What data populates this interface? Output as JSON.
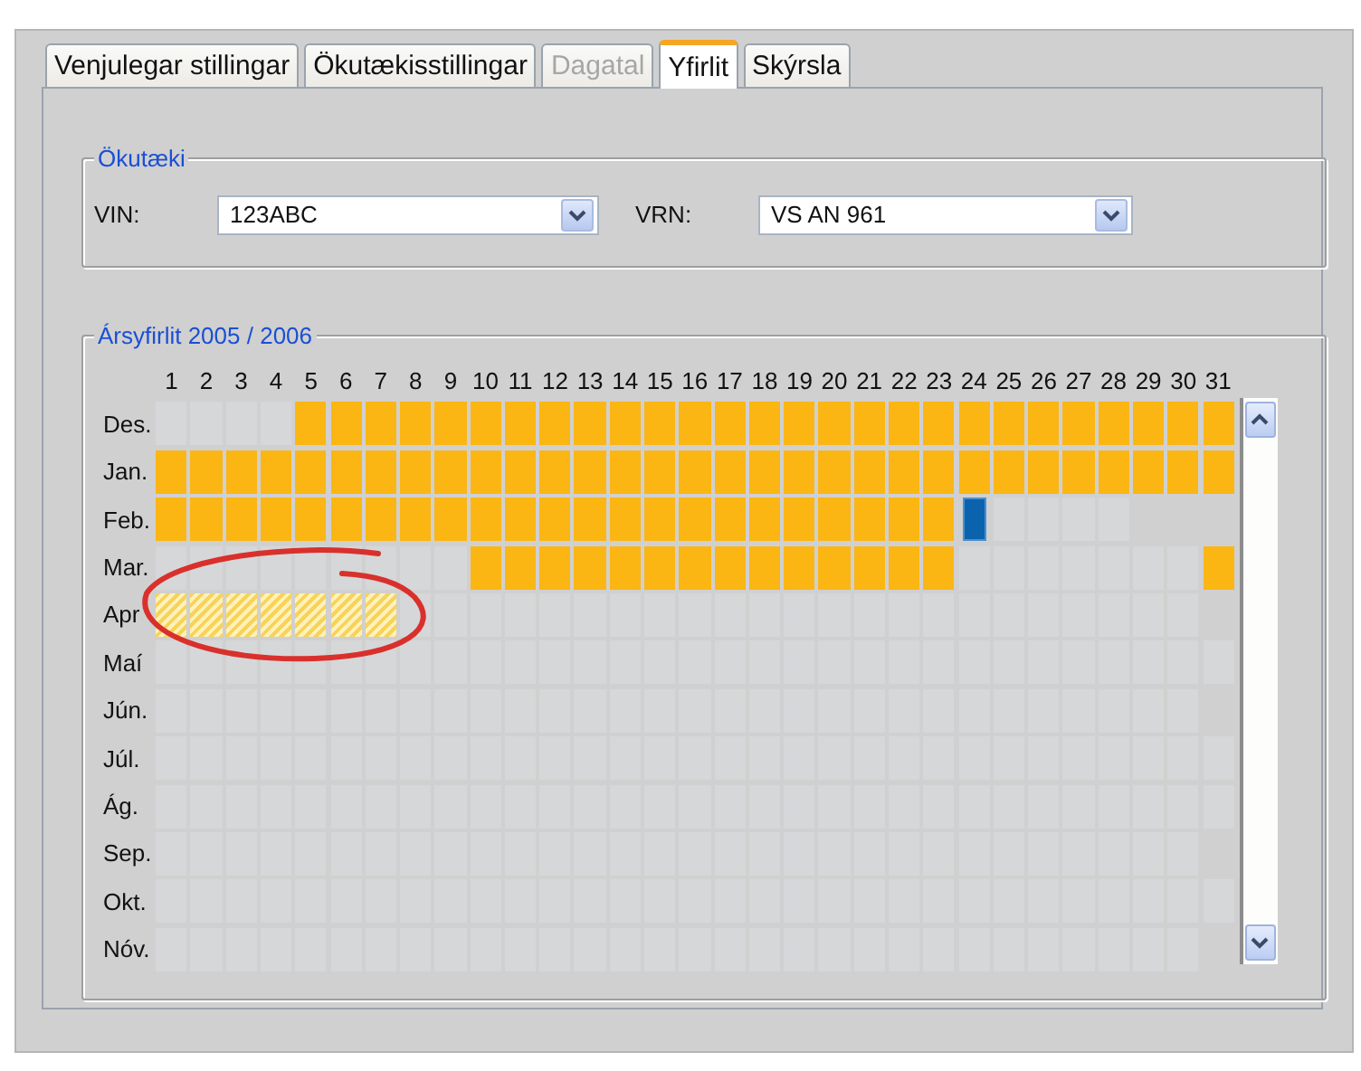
{
  "tabs": [
    {
      "label": "Venjulegar stillingar",
      "selected": false,
      "disabled": false
    },
    {
      "label": "Ökutækisstillingar",
      "selected": false,
      "disabled": false
    },
    {
      "label": "Dagatal",
      "selected": false,
      "disabled": true
    },
    {
      "label": "Yfirlit",
      "selected": true,
      "disabled": false
    },
    {
      "label": "Skýrsla",
      "selected": false,
      "disabled": false
    }
  ],
  "vehicle": {
    "title": "Ökutæki",
    "vin": {
      "label": "VIN:",
      "value": "123ABC"
    },
    "vrn": {
      "label": "VRN:",
      "value": "VS AN 961"
    }
  },
  "year_overview": {
    "title": "Ársyfirlit 2005 / 2006",
    "day_numbers": [
      "1",
      "2",
      "3",
      "4",
      "5",
      "6",
      "7",
      "8",
      "9",
      "10",
      "11",
      "12",
      "13",
      "14",
      "15",
      "16",
      "17",
      "18",
      "19",
      "20",
      "21",
      "22",
      "23",
      "24",
      "25",
      "26",
      "27",
      "28",
      "29",
      "30",
      "31"
    ],
    "months": [
      {
        "label": "Des.",
        "days": [
          {
            "kind": "empty"
          },
          {
            "kind": "empty"
          },
          {
            "kind": "empty"
          },
          {
            "kind": "empty"
          },
          {
            "kind": "filled"
          },
          {
            "kind": "filled"
          },
          {
            "kind": "filled"
          },
          {
            "kind": "filled"
          },
          {
            "kind": "filled"
          },
          {
            "kind": "filled"
          },
          {
            "kind": "filled"
          },
          {
            "kind": "filled"
          },
          {
            "kind": "filled"
          },
          {
            "kind": "filled"
          },
          {
            "kind": "filled"
          },
          {
            "kind": "filled"
          },
          {
            "kind": "filled"
          },
          {
            "kind": "filled"
          },
          {
            "kind": "filled"
          },
          {
            "kind": "filled"
          },
          {
            "kind": "filled"
          },
          {
            "kind": "filled"
          },
          {
            "kind": "filled"
          },
          {
            "kind": "filled"
          },
          {
            "kind": "filled"
          },
          {
            "kind": "filled"
          },
          {
            "kind": "filled"
          },
          {
            "kind": "filled"
          },
          {
            "kind": "filled"
          },
          {
            "kind": "filled"
          },
          {
            "kind": "filled"
          }
        ]
      },
      {
        "label": "Jan.",
        "days": [
          {
            "kind": "filled"
          },
          {
            "kind": "filled"
          },
          {
            "kind": "filled"
          },
          {
            "kind": "filled"
          },
          {
            "kind": "filled"
          },
          {
            "kind": "filled"
          },
          {
            "kind": "filled"
          },
          {
            "kind": "filled"
          },
          {
            "kind": "filled"
          },
          {
            "kind": "filled"
          },
          {
            "kind": "filled"
          },
          {
            "kind": "filled"
          },
          {
            "kind": "filled"
          },
          {
            "kind": "filled"
          },
          {
            "kind": "filled"
          },
          {
            "kind": "filled"
          },
          {
            "kind": "filled"
          },
          {
            "kind": "filled"
          },
          {
            "kind": "filled"
          },
          {
            "kind": "filled"
          },
          {
            "kind": "filled"
          },
          {
            "kind": "filled"
          },
          {
            "kind": "filled"
          },
          {
            "kind": "filled"
          },
          {
            "kind": "filled"
          },
          {
            "kind": "filled"
          },
          {
            "kind": "filled"
          },
          {
            "kind": "filled"
          },
          {
            "kind": "filled"
          },
          {
            "kind": "filled"
          },
          {
            "kind": "filled"
          }
        ]
      },
      {
        "label": "Feb.",
        "days": [
          {
            "kind": "filled"
          },
          {
            "kind": "filled"
          },
          {
            "kind": "filled"
          },
          {
            "kind": "filled"
          },
          {
            "kind": "filled"
          },
          {
            "kind": "filled"
          },
          {
            "kind": "filled"
          },
          {
            "kind": "filled"
          },
          {
            "kind": "filled"
          },
          {
            "kind": "filled"
          },
          {
            "kind": "filled"
          },
          {
            "kind": "filled"
          },
          {
            "kind": "filled"
          },
          {
            "kind": "filled"
          },
          {
            "kind": "filled"
          },
          {
            "kind": "filled"
          },
          {
            "kind": "filled"
          },
          {
            "kind": "filled"
          },
          {
            "kind": "filled"
          },
          {
            "kind": "filled"
          },
          {
            "kind": "filled"
          },
          {
            "kind": "filled"
          },
          {
            "kind": "filled"
          },
          {
            "kind": "selected"
          },
          {
            "kind": "empty"
          },
          {
            "kind": "empty"
          },
          {
            "kind": "empty"
          },
          {
            "kind": "empty"
          }
        ]
      },
      {
        "label": "Mar.",
        "days": [
          {
            "kind": "empty"
          },
          {
            "kind": "empty"
          },
          {
            "kind": "empty"
          },
          {
            "kind": "empty"
          },
          {
            "kind": "empty"
          },
          {
            "kind": "empty"
          },
          {
            "kind": "empty"
          },
          {
            "kind": "empty"
          },
          {
            "kind": "empty"
          },
          {
            "kind": "filled"
          },
          {
            "kind": "filled"
          },
          {
            "kind": "filled"
          },
          {
            "kind": "filled"
          },
          {
            "kind": "filled"
          },
          {
            "kind": "filled"
          },
          {
            "kind": "filled"
          },
          {
            "kind": "filled"
          },
          {
            "kind": "filled"
          },
          {
            "kind": "filled"
          },
          {
            "kind": "filled"
          },
          {
            "kind": "filled"
          },
          {
            "kind": "filled"
          },
          {
            "kind": "filled"
          },
          {
            "kind": "empty"
          },
          {
            "kind": "empty"
          },
          {
            "kind": "empty"
          },
          {
            "kind": "empty"
          },
          {
            "kind": "empty"
          },
          {
            "kind": "empty"
          },
          {
            "kind": "empty"
          },
          {
            "kind": "filled"
          }
        ]
      },
      {
        "label": "Apr",
        "days": [
          {
            "kind": "planned"
          },
          {
            "kind": "planned"
          },
          {
            "kind": "planned"
          },
          {
            "kind": "planned"
          },
          {
            "kind": "planned"
          },
          {
            "kind": "planned"
          },
          {
            "kind": "planned"
          },
          {
            "kind": "empty"
          },
          {
            "kind": "empty"
          },
          {
            "kind": "empty"
          },
          {
            "kind": "empty"
          },
          {
            "kind": "empty"
          },
          {
            "kind": "empty"
          },
          {
            "kind": "empty"
          },
          {
            "kind": "empty"
          },
          {
            "kind": "empty"
          },
          {
            "kind": "empty"
          },
          {
            "kind": "empty"
          },
          {
            "kind": "empty"
          },
          {
            "kind": "empty"
          },
          {
            "kind": "empty"
          },
          {
            "kind": "empty"
          },
          {
            "kind": "empty"
          },
          {
            "kind": "empty"
          },
          {
            "kind": "empty"
          },
          {
            "kind": "empty"
          },
          {
            "kind": "empty"
          },
          {
            "kind": "empty"
          },
          {
            "kind": "empty"
          },
          {
            "kind": "empty"
          }
        ]
      },
      {
        "label": "Maí",
        "days": [
          {
            "kind": "empty"
          },
          {
            "kind": "empty"
          },
          {
            "kind": "empty"
          },
          {
            "kind": "empty"
          },
          {
            "kind": "empty"
          },
          {
            "kind": "empty"
          },
          {
            "kind": "empty"
          },
          {
            "kind": "empty"
          },
          {
            "kind": "empty"
          },
          {
            "kind": "empty"
          },
          {
            "kind": "empty"
          },
          {
            "kind": "empty"
          },
          {
            "kind": "empty"
          },
          {
            "kind": "empty"
          },
          {
            "kind": "empty"
          },
          {
            "kind": "empty"
          },
          {
            "kind": "empty"
          },
          {
            "kind": "empty"
          },
          {
            "kind": "empty"
          },
          {
            "kind": "empty"
          },
          {
            "kind": "empty"
          },
          {
            "kind": "empty"
          },
          {
            "kind": "empty"
          },
          {
            "kind": "empty"
          },
          {
            "kind": "empty"
          },
          {
            "kind": "empty"
          },
          {
            "kind": "empty"
          },
          {
            "kind": "empty"
          },
          {
            "kind": "empty"
          },
          {
            "kind": "empty"
          },
          {
            "kind": "empty"
          }
        ]
      },
      {
        "label": "Jún.",
        "days": [
          {
            "kind": "empty"
          },
          {
            "kind": "empty"
          },
          {
            "kind": "empty"
          },
          {
            "kind": "empty"
          },
          {
            "kind": "empty"
          },
          {
            "kind": "empty"
          },
          {
            "kind": "empty"
          },
          {
            "kind": "empty"
          },
          {
            "kind": "empty"
          },
          {
            "kind": "empty"
          },
          {
            "kind": "empty"
          },
          {
            "kind": "empty"
          },
          {
            "kind": "empty"
          },
          {
            "kind": "empty"
          },
          {
            "kind": "empty"
          },
          {
            "kind": "empty"
          },
          {
            "kind": "empty"
          },
          {
            "kind": "empty"
          },
          {
            "kind": "empty"
          },
          {
            "kind": "empty"
          },
          {
            "kind": "empty"
          },
          {
            "kind": "empty"
          },
          {
            "kind": "empty"
          },
          {
            "kind": "empty"
          },
          {
            "kind": "empty"
          },
          {
            "kind": "empty"
          },
          {
            "kind": "empty"
          },
          {
            "kind": "empty"
          },
          {
            "kind": "empty"
          },
          {
            "kind": "empty"
          }
        ]
      },
      {
        "label": "Júl.",
        "days": [
          {
            "kind": "empty"
          },
          {
            "kind": "empty"
          },
          {
            "kind": "empty"
          },
          {
            "kind": "empty"
          },
          {
            "kind": "empty"
          },
          {
            "kind": "empty"
          },
          {
            "kind": "empty"
          },
          {
            "kind": "empty"
          },
          {
            "kind": "empty"
          },
          {
            "kind": "empty"
          },
          {
            "kind": "empty"
          },
          {
            "kind": "empty"
          },
          {
            "kind": "empty"
          },
          {
            "kind": "empty"
          },
          {
            "kind": "empty"
          },
          {
            "kind": "empty"
          },
          {
            "kind": "empty"
          },
          {
            "kind": "empty"
          },
          {
            "kind": "empty"
          },
          {
            "kind": "empty"
          },
          {
            "kind": "empty"
          },
          {
            "kind": "empty"
          },
          {
            "kind": "empty"
          },
          {
            "kind": "empty"
          },
          {
            "kind": "empty"
          },
          {
            "kind": "empty"
          },
          {
            "kind": "empty"
          },
          {
            "kind": "empty"
          },
          {
            "kind": "empty"
          },
          {
            "kind": "empty"
          },
          {
            "kind": "empty"
          }
        ]
      },
      {
        "label": "Ág.",
        "days": [
          {
            "kind": "empty"
          },
          {
            "kind": "empty"
          },
          {
            "kind": "empty"
          },
          {
            "kind": "empty"
          },
          {
            "kind": "empty"
          },
          {
            "kind": "empty"
          },
          {
            "kind": "empty"
          },
          {
            "kind": "empty"
          },
          {
            "kind": "empty"
          },
          {
            "kind": "empty"
          },
          {
            "kind": "empty"
          },
          {
            "kind": "empty"
          },
          {
            "kind": "empty"
          },
          {
            "kind": "empty"
          },
          {
            "kind": "empty"
          },
          {
            "kind": "empty"
          },
          {
            "kind": "empty"
          },
          {
            "kind": "empty"
          },
          {
            "kind": "empty"
          },
          {
            "kind": "empty"
          },
          {
            "kind": "empty"
          },
          {
            "kind": "empty"
          },
          {
            "kind": "empty"
          },
          {
            "kind": "empty"
          },
          {
            "kind": "empty"
          },
          {
            "kind": "empty"
          },
          {
            "kind": "empty"
          },
          {
            "kind": "empty"
          },
          {
            "kind": "empty"
          },
          {
            "kind": "empty"
          },
          {
            "kind": "empty"
          }
        ]
      },
      {
        "label": "Sep.",
        "days": [
          {
            "kind": "empty"
          },
          {
            "kind": "empty"
          },
          {
            "kind": "empty"
          },
          {
            "kind": "empty"
          },
          {
            "kind": "empty"
          },
          {
            "kind": "empty"
          },
          {
            "kind": "empty"
          },
          {
            "kind": "empty"
          },
          {
            "kind": "empty"
          },
          {
            "kind": "empty"
          },
          {
            "kind": "empty"
          },
          {
            "kind": "empty"
          },
          {
            "kind": "empty"
          },
          {
            "kind": "empty"
          },
          {
            "kind": "empty"
          },
          {
            "kind": "empty"
          },
          {
            "kind": "empty"
          },
          {
            "kind": "empty"
          },
          {
            "kind": "empty"
          },
          {
            "kind": "empty"
          },
          {
            "kind": "empty"
          },
          {
            "kind": "empty"
          },
          {
            "kind": "empty"
          },
          {
            "kind": "empty"
          },
          {
            "kind": "empty"
          },
          {
            "kind": "empty"
          },
          {
            "kind": "empty"
          },
          {
            "kind": "empty"
          },
          {
            "kind": "empty"
          },
          {
            "kind": "empty"
          }
        ]
      },
      {
        "label": "Okt.",
        "days": [
          {
            "kind": "empty"
          },
          {
            "kind": "empty"
          },
          {
            "kind": "empty"
          },
          {
            "kind": "empty"
          },
          {
            "kind": "empty"
          },
          {
            "kind": "empty"
          },
          {
            "kind": "empty"
          },
          {
            "kind": "empty"
          },
          {
            "kind": "empty"
          },
          {
            "kind": "empty"
          },
          {
            "kind": "empty"
          },
          {
            "kind": "empty"
          },
          {
            "kind": "empty"
          },
          {
            "kind": "empty"
          },
          {
            "kind": "empty"
          },
          {
            "kind": "empty"
          },
          {
            "kind": "empty"
          },
          {
            "kind": "empty"
          },
          {
            "kind": "empty"
          },
          {
            "kind": "empty"
          },
          {
            "kind": "empty"
          },
          {
            "kind": "empty"
          },
          {
            "kind": "empty"
          },
          {
            "kind": "empty"
          },
          {
            "kind": "empty"
          },
          {
            "kind": "empty"
          },
          {
            "kind": "empty"
          },
          {
            "kind": "empty"
          },
          {
            "kind": "empty"
          },
          {
            "kind": "empty"
          },
          {
            "kind": "empty"
          }
        ]
      },
      {
        "label": "Nóv.",
        "days": [
          {
            "kind": "empty"
          },
          {
            "kind": "empty"
          },
          {
            "kind": "empty"
          },
          {
            "kind": "empty"
          },
          {
            "kind": "empty"
          },
          {
            "kind": "empty"
          },
          {
            "kind": "empty"
          },
          {
            "kind": "empty"
          },
          {
            "kind": "empty"
          },
          {
            "kind": "empty"
          },
          {
            "kind": "empty"
          },
          {
            "kind": "empty"
          },
          {
            "kind": "empty"
          },
          {
            "kind": "empty"
          },
          {
            "kind": "empty"
          },
          {
            "kind": "empty"
          },
          {
            "kind": "empty"
          },
          {
            "kind": "empty"
          },
          {
            "kind": "empty"
          },
          {
            "kind": "empty"
          },
          {
            "kind": "empty"
          },
          {
            "kind": "empty"
          },
          {
            "kind": "empty"
          },
          {
            "kind": "empty"
          },
          {
            "kind": "empty"
          },
          {
            "kind": "empty"
          },
          {
            "kind": "empty"
          },
          {
            "kind": "empty"
          },
          {
            "kind": "empty"
          },
          {
            "kind": "empty"
          }
        ]
      }
    ]
  }
}
